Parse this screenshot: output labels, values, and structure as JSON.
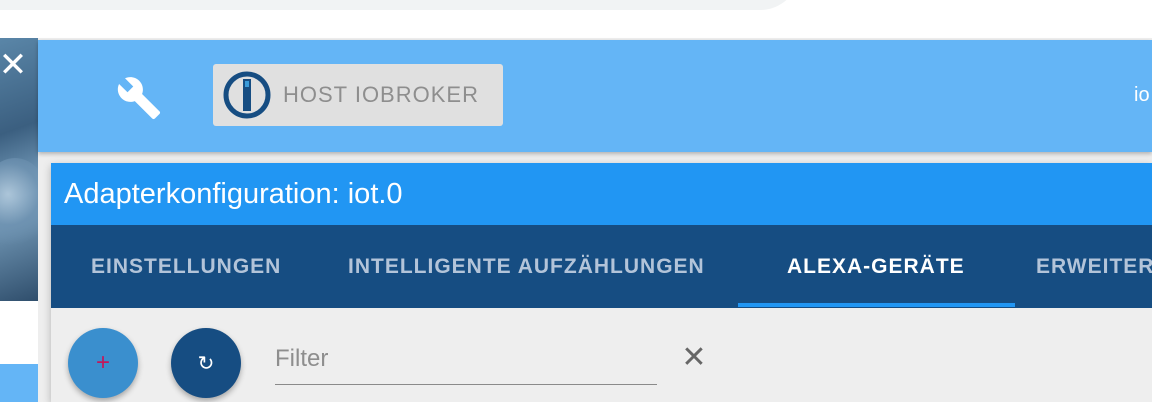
{
  "icons": {
    "close": "close-icon",
    "wrench": "wrench-icon",
    "logo": "iobroker-logo-icon",
    "add": "plus-icon",
    "refresh": "refresh-icon",
    "clear": "clear-icon"
  },
  "colors": {
    "appbar": "#64b5f6",
    "dialog_title": "#2196f3",
    "tabs_bg": "#164d82",
    "tab_indicator": "#2196f3"
  },
  "sidebar": {
    "close_glyph": "✕"
  },
  "appbar": {
    "host_label": "HOST IOBROKER",
    "right_text": "io"
  },
  "dialog": {
    "title": "Adapterkonfiguration: iot.0",
    "tabs": [
      {
        "label": "EINSTELLUNGEN",
        "active": false
      },
      {
        "label": "INTELLIGENTE AUFZÄHLUNGEN",
        "active": false
      },
      {
        "label": "ALEXA-GERÄTE",
        "active": true
      },
      {
        "label": "ERWEITER",
        "active": false
      }
    ]
  },
  "toolbar": {
    "add_glyph": "+",
    "refresh_glyph": "↻",
    "filter_placeholder": "Filter",
    "filter_value": "",
    "clear_glyph": "✕"
  }
}
